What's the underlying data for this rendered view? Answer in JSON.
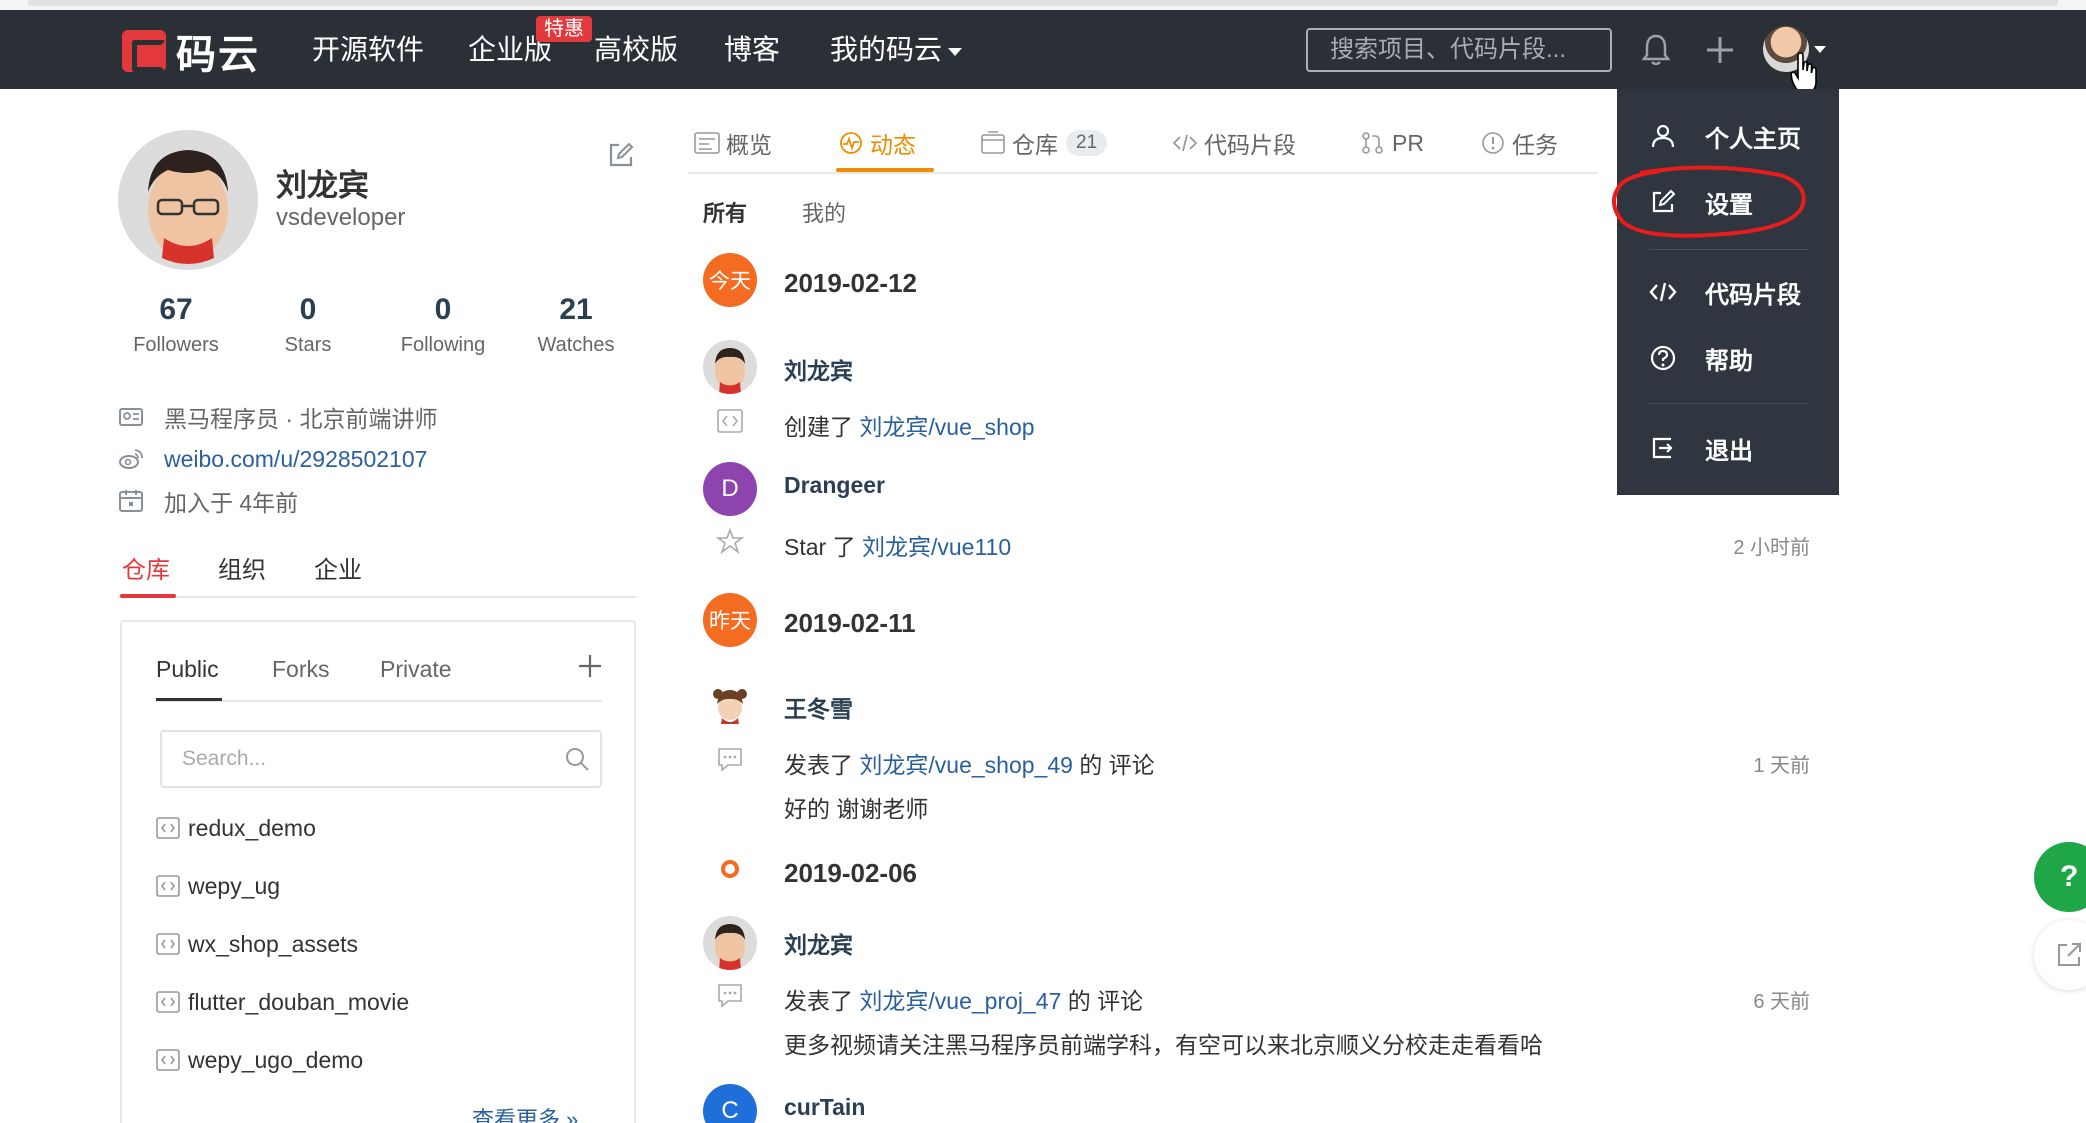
{
  "navbar": {
    "logo_text": "码云",
    "items": [
      "开源软件",
      "企业版",
      "高校版",
      "博客",
      "我的码云"
    ],
    "badge": "特惠",
    "search_placeholder": "搜索项目、代码片段..."
  },
  "dropdown": {
    "items": [
      {
        "label": "个人主页",
        "icon": "user-icon"
      },
      {
        "label": "设置",
        "icon": "edit-icon"
      },
      {
        "label": "代码片段",
        "icon": "code-icon"
      },
      {
        "label": "帮助",
        "icon": "help-icon"
      },
      {
        "label": "退出",
        "icon": "logout-icon"
      }
    ]
  },
  "profile": {
    "name": "刘龙宾",
    "username": "vsdeveloper",
    "stats": [
      {
        "num": "67",
        "label": "Followers"
      },
      {
        "num": "0",
        "label": "Stars"
      },
      {
        "num": "0",
        "label": "Following"
      },
      {
        "num": "21",
        "label": "Watches"
      }
    ],
    "info": {
      "company": "黑马程序员 · 北京前端讲师",
      "weibo": "weibo.com/u/2928502107",
      "joined": "加入于 4年前"
    },
    "tabs": [
      "仓库",
      "组织",
      "企业"
    ]
  },
  "repos": {
    "tabs": [
      "Public",
      "Forks",
      "Private"
    ],
    "search_placeholder": "Search...",
    "items": [
      "redux_demo",
      "wepy_ug",
      "wx_shop_assets",
      "flutter_douban_movie",
      "wepy_ugo_demo"
    ],
    "see_more": "查看更多 »"
  },
  "main": {
    "tabs": [
      {
        "label": "概览"
      },
      {
        "label": "动态"
      },
      {
        "label": "仓库",
        "count": "21"
      },
      {
        "label": "代码片段"
      },
      {
        "label": "PR"
      },
      {
        "label": "任务"
      }
    ],
    "filters": [
      "所有",
      "我的"
    ]
  },
  "feed": {
    "day1": {
      "badge": "今天",
      "date": "2019-02-12"
    },
    "e1": {
      "user": "刘龙宾",
      "action": "创建了",
      "target": "刘龙宾/vue_shop"
    },
    "e2": {
      "user": "Drangeer",
      "initial": "D",
      "action": "Star 了",
      "target": "刘龙宾/vue110",
      "time": "2 小时前"
    },
    "day2": {
      "badge": "昨天",
      "date": "2019-02-11"
    },
    "e3": {
      "user": "王冬雪",
      "action": "发表了",
      "target": "刘龙宾/vue_shop_49",
      "suffix": "的 评论",
      "comment": "好的 谢谢老师",
      "time": "1 天前"
    },
    "day3": {
      "date": "2019-02-06"
    },
    "e4": {
      "user": "刘龙宾",
      "action": "发表了",
      "target": "刘龙宾/vue_proj_47",
      "suffix": "的 评论",
      "comment": "更多视频请关注黑马程序员前端学科，有空可以来北京顺义分校走走看看哈",
      "time": "6 天前"
    },
    "e5": {
      "user": "curTain",
      "initial": "C"
    }
  },
  "fab": {
    "help": "?"
  },
  "colors": {
    "navbar": "#2b3037",
    "accent": "#f08c00",
    "brand_red": "#e4393c",
    "link": "#2a5f9e",
    "feed_orange": "#f36c21",
    "help_green": "#1fa647"
  }
}
